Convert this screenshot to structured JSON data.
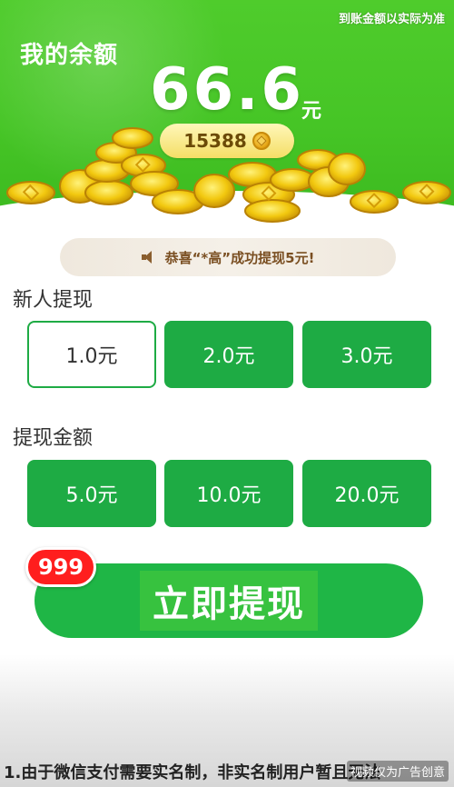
{
  "hero": {
    "note": "到账金额以实际为准",
    "balance_title": "我的余额",
    "balance_amount": "66.6",
    "balance_unit": "元",
    "coin_count": "15388",
    "coin_icon": "coin-icon",
    "color_green": "#46c526"
  },
  "notice": {
    "icon": "speaker-icon",
    "text": "恭喜“*高”成功提现5元!"
  },
  "new_user": {
    "label": "新人提现",
    "options": [
      {
        "label": "1.0元",
        "selected": true
      },
      {
        "label": "2.0元",
        "selected": false
      },
      {
        "label": "3.0元",
        "selected": false
      }
    ]
  },
  "amount": {
    "label": "提现金额",
    "options": [
      {
        "label": "5.0元"
      },
      {
        "label": "10.0元"
      },
      {
        "label": "20.0元"
      }
    ]
  },
  "cta": {
    "label": "立即提现",
    "badge": "999",
    "color": "#1fb646"
  },
  "footer": {
    "text": "1.由于微信支付需要实名制，非实名制用户暂且无法",
    "watermark": "视频仅为广告创意"
  }
}
